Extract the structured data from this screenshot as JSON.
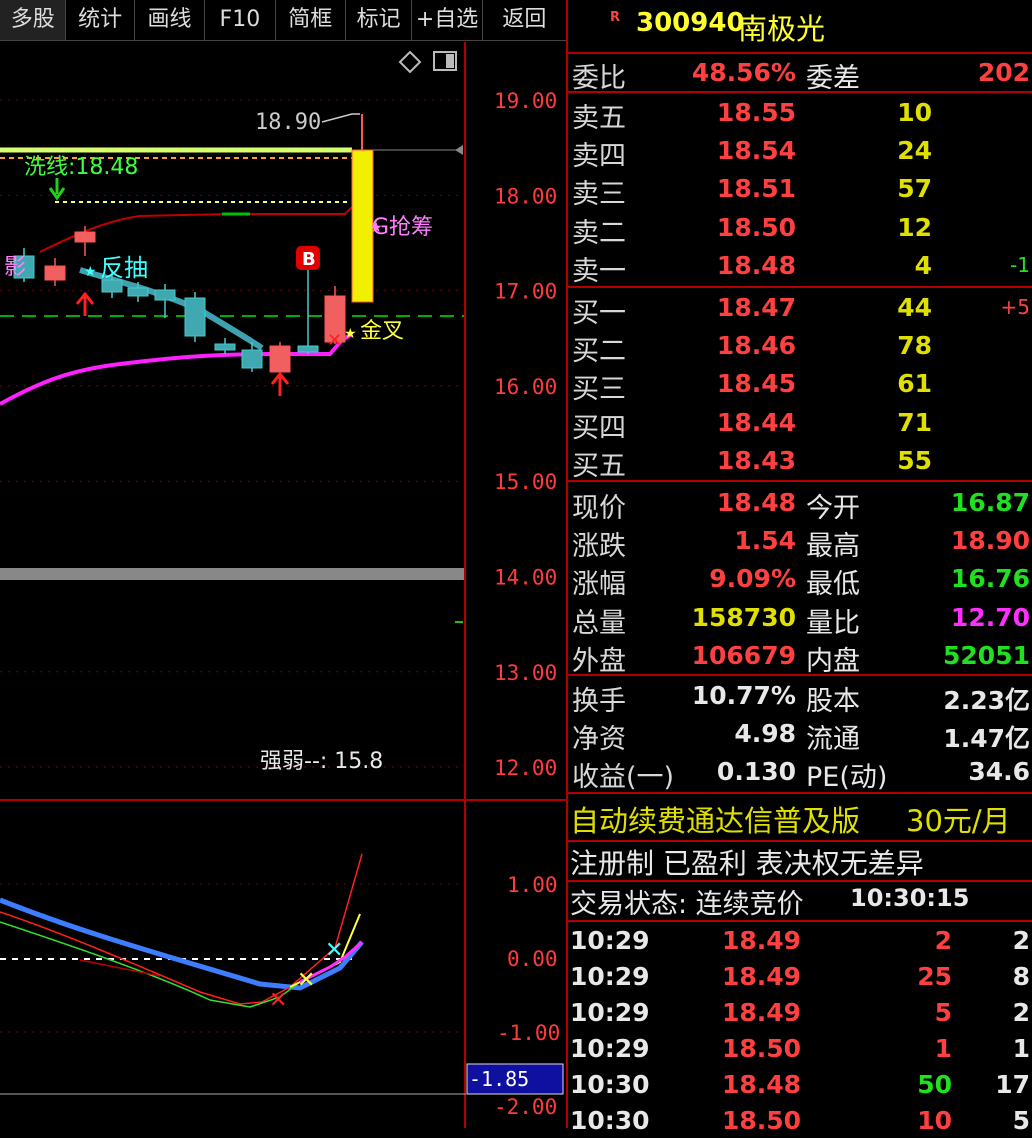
{
  "toolbar": {
    "buttons": [
      "多股",
      "统计",
      "画线",
      "F10",
      "简框",
      "标记",
      "+自选",
      "返回"
    ]
  },
  "chart": {
    "price_axis": [
      "19.00",
      "18.00",
      "17.00",
      "16.00",
      "15.00",
      "14.00",
      "13.00",
      "12.00"
    ],
    "indicator_axis": [
      "1.00",
      "0.00",
      "-1.00",
      "-2.00"
    ],
    "current_indicator": "-1.85",
    "labels": {
      "high_mark": "18.90",
      "wash_line": "洗线:18.48",
      "g_grab": "G抢筹",
      "fanchou": "反抽",
      "gold_cross": "金叉",
      "strength": "强弱--: 15.8",
      "buy_badge": "B"
    },
    "colors": {
      "up": "#ff5555",
      "down": "#44cccc",
      "ma_magenta": "#ff20ff",
      "ma_teal": "#3fa0b0",
      "limit_up_bar": "#f0f000"
    }
  },
  "header": {
    "r_badge": "R",
    "code": "300940",
    "name": "南极光"
  },
  "order_ratio": {
    "label_ratio": "委比",
    "ratio": "48.56%",
    "label_diff": "委差",
    "diff": "202"
  },
  "sell": [
    {
      "label": "卖五",
      "price": "18.55",
      "vol": "10",
      "chg": ""
    },
    {
      "label": "卖四",
      "price": "18.54",
      "vol": "24",
      "chg": ""
    },
    {
      "label": "卖三",
      "price": "18.51",
      "vol": "57",
      "chg": ""
    },
    {
      "label": "卖二",
      "price": "18.50",
      "vol": "12",
      "chg": ""
    },
    {
      "label": "卖一",
      "price": "18.48",
      "vol": "4",
      "chg": "-1"
    }
  ],
  "buy": [
    {
      "label": "买一",
      "price": "18.47",
      "vol": "44",
      "chg": "+5"
    },
    {
      "label": "买二",
      "price": "18.46",
      "vol": "78",
      "chg": ""
    },
    {
      "label": "买三",
      "price": "18.45",
      "vol": "61",
      "chg": ""
    },
    {
      "label": "买四",
      "price": "18.44",
      "vol": "71",
      "chg": ""
    },
    {
      "label": "买五",
      "price": "18.43",
      "vol": "55",
      "chg": ""
    }
  ],
  "quote": [
    {
      "l1": "现价",
      "v1": "18.48",
      "c1": "red",
      "l2": "今开",
      "v2": "16.87",
      "c2": "grn"
    },
    {
      "l1": "涨跌",
      "v1": "1.54",
      "c1": "red",
      "l2": "最高",
      "v2": "18.90",
      "c2": "red"
    },
    {
      "l1": "涨幅",
      "v1": "9.09%",
      "c1": "red",
      "l2": "最低",
      "v2": "16.76",
      "c2": "grn"
    },
    {
      "l1": "总量",
      "v1": "158730",
      "c1": "yel",
      "l2": "量比",
      "v2": "12.70",
      "c2": "mag"
    },
    {
      "l1": "外盘",
      "v1": "106679",
      "c1": "red",
      "l2": "内盘",
      "v2": "52051",
      "c2": "grn"
    }
  ],
  "fundamentals": [
    {
      "l1": "换手",
      "v1": "10.77%",
      "l2": "股本",
      "v2": "2.23亿"
    },
    {
      "l1": "净资",
      "v1": "4.98",
      "l2": "流通",
      "v2": "1.47亿"
    },
    {
      "l1": "收益(一)",
      "v1": "0.130",
      "l2": "PE(动)",
      "v2": "34.6"
    }
  ],
  "promo": {
    "text": "自动续费通达信普及版",
    "price": "30元/月"
  },
  "notice": "注册制 已盈利 表决权无差异",
  "trade_status": {
    "label": "交易状态: 连续竞价",
    "time": "10:30:15"
  },
  "ticks": [
    {
      "time": "10:29",
      "price": "18.49",
      "vol": "2",
      "n": "2",
      "color": "red"
    },
    {
      "time": "10:29",
      "price": "18.49",
      "vol": "25",
      "n": "8",
      "color": "red"
    },
    {
      "time": "10:29",
      "price": "18.49",
      "vol": "5",
      "n": "2",
      "color": "red"
    },
    {
      "time": "10:29",
      "price": "18.50",
      "vol": "1",
      "n": "1",
      "color": "red"
    },
    {
      "time": "10:30",
      "price": "18.48",
      "vol": "50",
      "n": "17",
      "color": "grn"
    },
    {
      "time": "10:30",
      "price": "18.50",
      "vol": "10",
      "n": "5",
      "color": "red"
    }
  ]
}
